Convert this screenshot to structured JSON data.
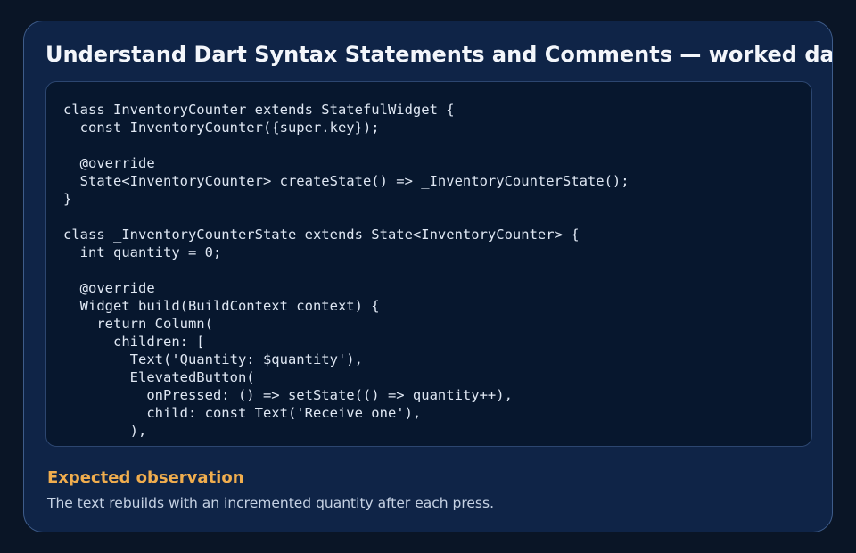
{
  "page": {
    "title": "Understand Dart Syntax Statements and Comments — worked dart"
  },
  "code_block": {
    "language": "dart",
    "lines": [
      "class InventoryCounter extends StatefulWidget {",
      "  const InventoryCounter({super.key});",
      "",
      "  @override",
      "  State<InventoryCounter> createState() => _InventoryCounterState();",
      "}",
      "",
      "class _InventoryCounterState extends State<InventoryCounter> {",
      "  int quantity = 0;",
      "",
      "  @override",
      "  Widget build(BuildContext context) {",
      "    return Column(",
      "      children: [",
      "        Text('Quantity: $quantity'),",
      "        ElevatedButton(",
      "          onPressed: () => setState(() => quantity++),",
      "          child: const Text('Receive one'),",
      "        ),"
    ]
  },
  "observation": {
    "heading": "Expected observation",
    "text": "The text rebuilds with an incremented quantity after each press."
  },
  "colors": {
    "page_background": "#0a1526",
    "card_background": "#0f2447",
    "code_background": "#07172e",
    "accent_heading": "#f0ad4e",
    "title_text": "#f3f6fb"
  }
}
